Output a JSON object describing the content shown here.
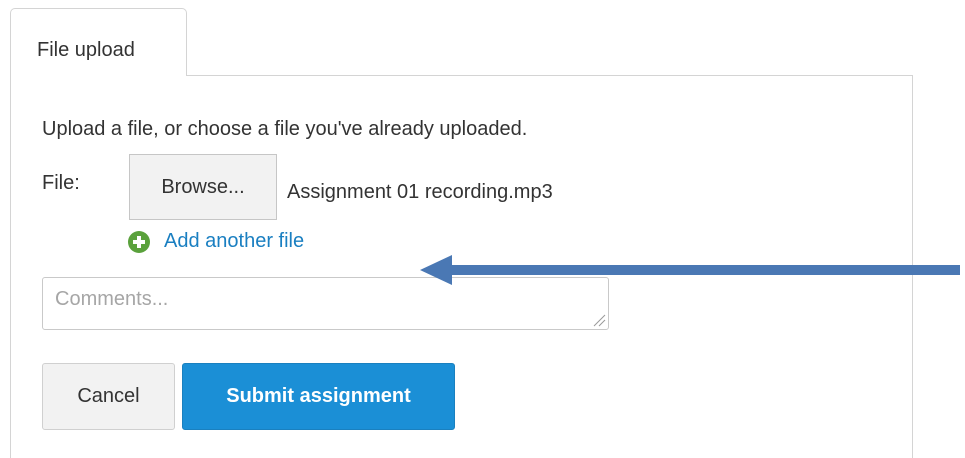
{
  "tab": {
    "label": "File upload"
  },
  "form": {
    "instructions": "Upload a file, or choose a file you've already uploaded.",
    "file_label": "File:",
    "browse_label": "Browse...",
    "selected_file": "Assignment 01 recording.mp3",
    "add_file_label": "Add another file",
    "comments_placeholder": "Comments...",
    "comments_value": ""
  },
  "actions": {
    "cancel_label": "Cancel",
    "submit_label": "Submit assignment"
  },
  "icons": {
    "add": "plus-circle-icon",
    "annotation": "left-arrow-annotation"
  },
  "colors": {
    "link": "#1a7fc1",
    "primary_button": "#1b8fd6",
    "add_icon": "#5aa13c",
    "arrow": "#4a78b4"
  }
}
